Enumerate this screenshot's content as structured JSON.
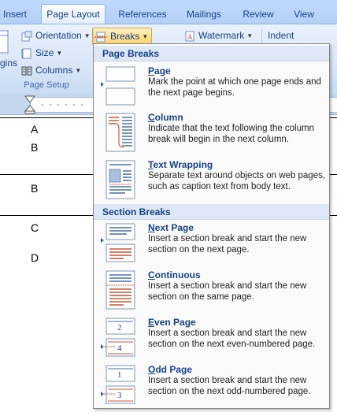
{
  "tabs": [
    "Insert",
    "Page Layout",
    "References",
    "Mailings",
    "Review",
    "View"
  ],
  "ribbon": {
    "orientation_label": "Orientation",
    "size_label": "Size",
    "columns_label": "Columns",
    "breaks_label": "Breaks",
    "margins_partial_label": "gins",
    "page_setup_label": "Page Setup",
    "watermark_label": "Watermark",
    "indent_label": "Indent"
  },
  "document": {
    "letters": [
      "A",
      "B",
      "B",
      "C",
      "D"
    ]
  },
  "menu": {
    "page_breaks_header": "Page Breaks",
    "section_breaks_header": "Section Breaks",
    "items": [
      {
        "title_underline": "P",
        "title_rest": "age",
        "desc": "Mark the point at which one page ends and the next page begins."
      },
      {
        "title_underline": "C",
        "title_rest": "olumn",
        "desc": "Indicate that the text following the column break will begin in the next column."
      },
      {
        "title_underline": "T",
        "title_rest": "ext Wrapping",
        "desc": "Separate text around objects on web pages, such as caption text from body text."
      },
      {
        "title_underline": "N",
        "title_rest": "ext Page",
        "desc": "Insert a section break and start the new section on the next page."
      },
      {
        "title_underline": "C",
        "title_rest": "ontinuous",
        "desc": "Insert a section break and start the new section on the same page."
      },
      {
        "title_underline": "E",
        "title_rest": "ven Page",
        "desc": "Insert a section break and start the new section on the next even-numbered page."
      },
      {
        "title_underline": "O",
        "title_rest": "dd Page",
        "desc": "Insert a section break and start the new section on the next odd-numbered page."
      }
    ],
    "even_page_numbers": [
      "2",
      "4"
    ],
    "odd_page_numbers": [
      "1",
      "3"
    ]
  },
  "colors": {
    "accent": "#15428b",
    "menu_header_bg": "#dde7f5",
    "breaks_highlight": "#ffd36a",
    "break_marker": "#e0562b"
  }
}
